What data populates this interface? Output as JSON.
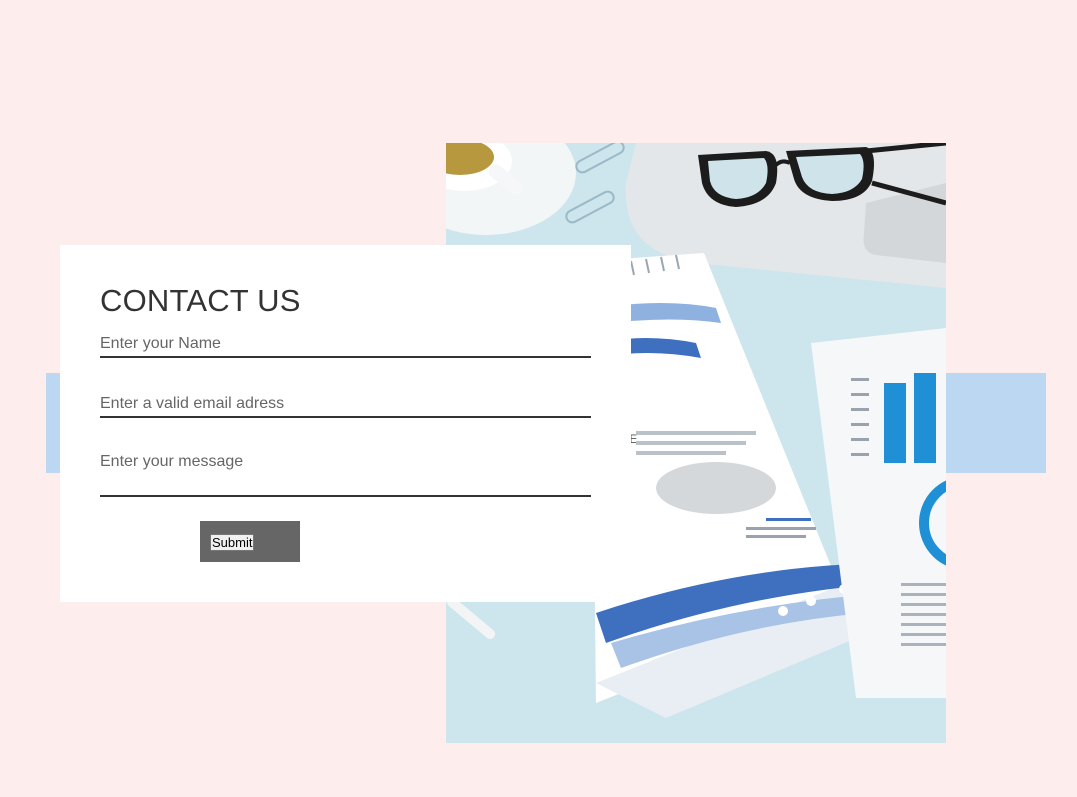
{
  "contact": {
    "title": "CONTACT US",
    "name_placeholder": "Enter your Name",
    "email_placeholder": "Enter a valid email adress",
    "message_placeholder": "Enter your message",
    "submit_label": "Submit"
  },
  "photo": {
    "description": "desk-with-laptop-glasses-and-report",
    "icon": "photo-image"
  },
  "colors": {
    "background": "#fdeeed",
    "band": "#bcd7f1",
    "card": "#ffffff",
    "button_bg": "#666666"
  }
}
